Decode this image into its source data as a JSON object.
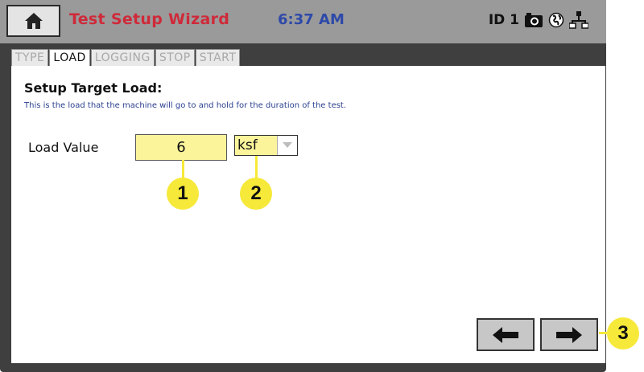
{
  "header": {
    "home_icon": "home-icon",
    "title": "Test Setup Wizard",
    "time": "6:37 AM",
    "id_label": "ID 1",
    "status_icons": [
      "camera-icon",
      "globe-icon",
      "network-icon"
    ],
    "title_color": "#cf2a3a",
    "time_color": "#2e49a8"
  },
  "tabs": [
    {
      "label": "TYPE",
      "active": false
    },
    {
      "label": "LOAD",
      "active": true
    },
    {
      "label": "LOGGING",
      "active": false
    },
    {
      "label": "STOP",
      "active": false
    },
    {
      "label": "START",
      "active": false
    }
  ],
  "main": {
    "heading": "Setup Target Load:",
    "description": "This is the load that the machine will go to and hold for the duration of the test.",
    "load_label": "Load Value",
    "load_value": "6",
    "unit_value": "ksf"
  },
  "callouts": [
    "1",
    "2",
    "3"
  ],
  "nav": {
    "back_icon": "arrow-left-icon",
    "next_icon": "arrow-right-icon"
  },
  "colors": {
    "input_highlight": "#fbf49b",
    "callout": "#f6e93a"
  }
}
